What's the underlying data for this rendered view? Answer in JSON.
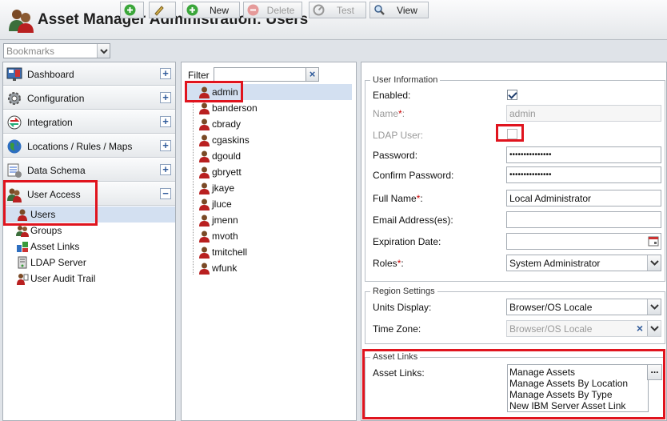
{
  "app": {
    "title": "Asset Manager Administration: Users"
  },
  "toolbar": {
    "bookmarks_placeholder": "Bookmarks",
    "new_label": "New",
    "delete_label": "Delete",
    "test_label": "Test",
    "view_label": "View"
  },
  "nav": {
    "items": [
      {
        "label": "Dashboard",
        "icon": "dashboard-icon"
      },
      {
        "label": "Configuration",
        "icon": "gear-icon"
      },
      {
        "label": "Integration",
        "icon": "integration-icon"
      },
      {
        "label": "Locations / Rules / Maps",
        "icon": "globe-icon"
      },
      {
        "label": "Data Schema",
        "icon": "data-schema-icon"
      },
      {
        "label": "User Access",
        "icon": "users-icon",
        "expanded": true
      }
    ],
    "subitems": [
      {
        "label": "Users",
        "icon": "user-icon",
        "selected": true
      },
      {
        "label": "Groups",
        "icon": "group-icon"
      },
      {
        "label": "Asset Links",
        "icon": "asset-links-icon"
      },
      {
        "label": "LDAP Server",
        "icon": "ldap-server-icon"
      },
      {
        "label": "User Audit Trail",
        "icon": "audit-trail-icon"
      }
    ],
    "expand_symbol": "+",
    "collapse_symbol": "−"
  },
  "user_list": {
    "filter_label": "Filter",
    "filter_value": "",
    "clear_symbol": "×",
    "users": [
      "admin",
      "banderson",
      "cbrady",
      "cgaskins",
      "dgould",
      "gbryett",
      "jkaye",
      "jluce",
      "jmenn",
      "mvoth",
      "tmitchell",
      "wfunk"
    ],
    "selected": "admin"
  },
  "details": {
    "user_info_legend": "User Information",
    "enabled_label": "Enabled:",
    "enabled": true,
    "name_label": "Name",
    "name_value": "admin",
    "ldap_label": "LDAP User:",
    "ldap": false,
    "password_label": "Password:",
    "password_value": "•••••••••••••••",
    "confirm_password_label": "Confirm Password:",
    "confirm_password_value": "•••••••••••••••",
    "full_name_label": "Full Name",
    "full_name_value": "Local Administrator",
    "email_label": "Email Address(es):",
    "email_value": "",
    "expiration_label": "Expiration Date:",
    "expiration_value": "",
    "roles_label": "Roles",
    "roles_value": "System Administrator",
    "required_mark": "*",
    "region_legend": "Region Settings",
    "units_label": "Units Display:",
    "units_value": "Browser/OS Locale",
    "timezone_label": "Time Zone:",
    "timezone_value": "Browser/OS Locale",
    "asset_links_legend": "Asset Links",
    "asset_links_label": "Asset Links:",
    "asset_links": [
      "Manage Assets",
      "Manage Assets By Location",
      "Manage Assets By Type",
      "New IBM Server Asset Link"
    ],
    "more_symbol": "..."
  },
  "colors": {
    "highlight": "#e0141e",
    "selection": "#d3e0f1",
    "required": "#cc0000"
  }
}
